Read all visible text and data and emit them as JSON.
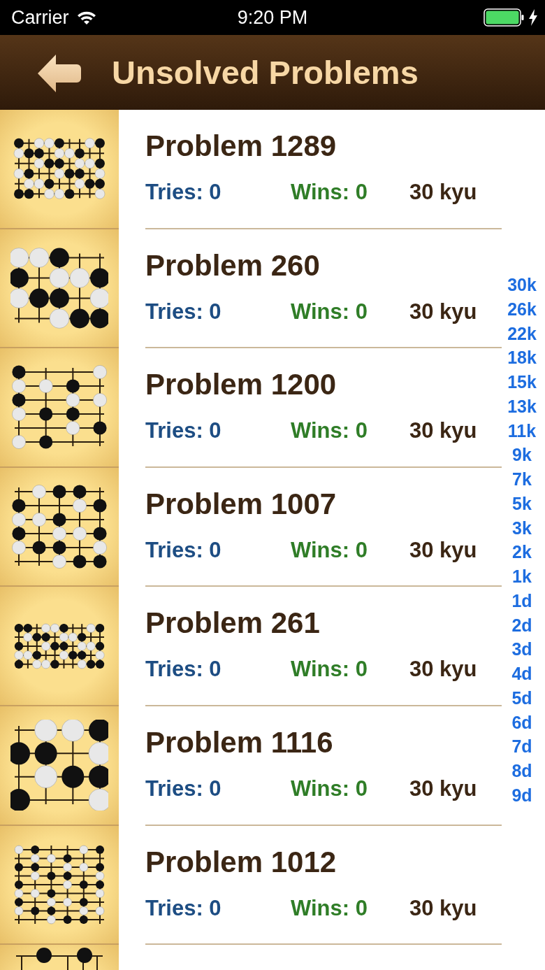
{
  "status_bar": {
    "carrier": "Carrier",
    "time": "9:20 PM"
  },
  "header": {
    "title": "Unsolved Problems"
  },
  "rows": [
    {
      "kind": "problem",
      "title": "Problem 1289",
      "tries": "Tries: 0",
      "wins": "Wins: 0",
      "rank": "30 kyu"
    },
    {
      "kind": "problem",
      "title": "Problem 260",
      "tries": "Tries: 0",
      "wins": "Wins: 0",
      "rank": "30 kyu"
    },
    {
      "kind": "problem",
      "title": "Problem 1200",
      "tries": "Tries: 0",
      "wins": "Wins: 0",
      "rank": "30 kyu"
    },
    {
      "kind": "problem",
      "title": "Problem 1007",
      "tries": "Tries: 0",
      "wins": "Wins: 0",
      "rank": "30 kyu"
    },
    {
      "kind": "problem",
      "title": "Problem 261",
      "tries": "Tries: 0",
      "wins": "Wins: 0",
      "rank": "30 kyu"
    },
    {
      "kind": "problem",
      "title": "Problem 1116",
      "tries": "Tries: 0",
      "wins": "Wins: 0",
      "rank": "30 kyu"
    },
    {
      "kind": "problem",
      "title": "Problem 1012",
      "tries": "Tries: 0",
      "wins": "Wins: 0",
      "rank": "30 kyu"
    },
    {
      "kind": "partial"
    }
  ],
  "index": [
    "30k",
    "26k",
    "22k",
    "18k",
    "15k",
    "13k",
    "11k",
    "9k",
    "7k",
    "5k",
    "3k",
    "2k",
    "1k",
    "1d",
    "2d",
    "3d",
    "4d",
    "5d",
    "6d",
    "7d",
    "8d",
    "9d"
  ]
}
